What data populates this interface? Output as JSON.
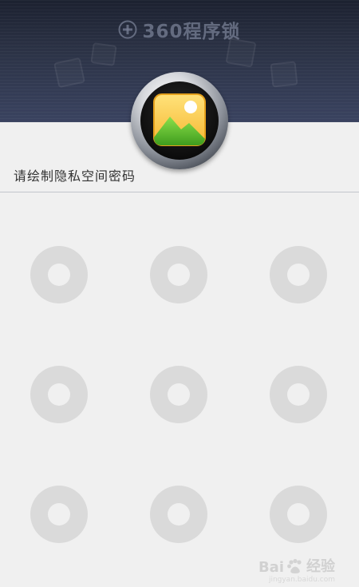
{
  "header": {
    "title": "360程序锁",
    "title_icon": "plus-circle-icon"
  },
  "app_icon": {
    "icon": "gallery-icon"
  },
  "prompt": {
    "text": "请绘制隐私空间密码"
  },
  "pattern": {
    "dots": [
      "1",
      "2",
      "3",
      "4",
      "5",
      "6",
      "7",
      "8",
      "9"
    ]
  },
  "watermark": {
    "brand": "Bai",
    "brand_suffix": "经验",
    "url": "jingyan.baidu.com"
  },
  "colors": {
    "header_dark": "#1c2130",
    "header_light": "#3a4360",
    "background": "#f0f0f0",
    "dot": "#dadada",
    "text": "#333333"
  }
}
